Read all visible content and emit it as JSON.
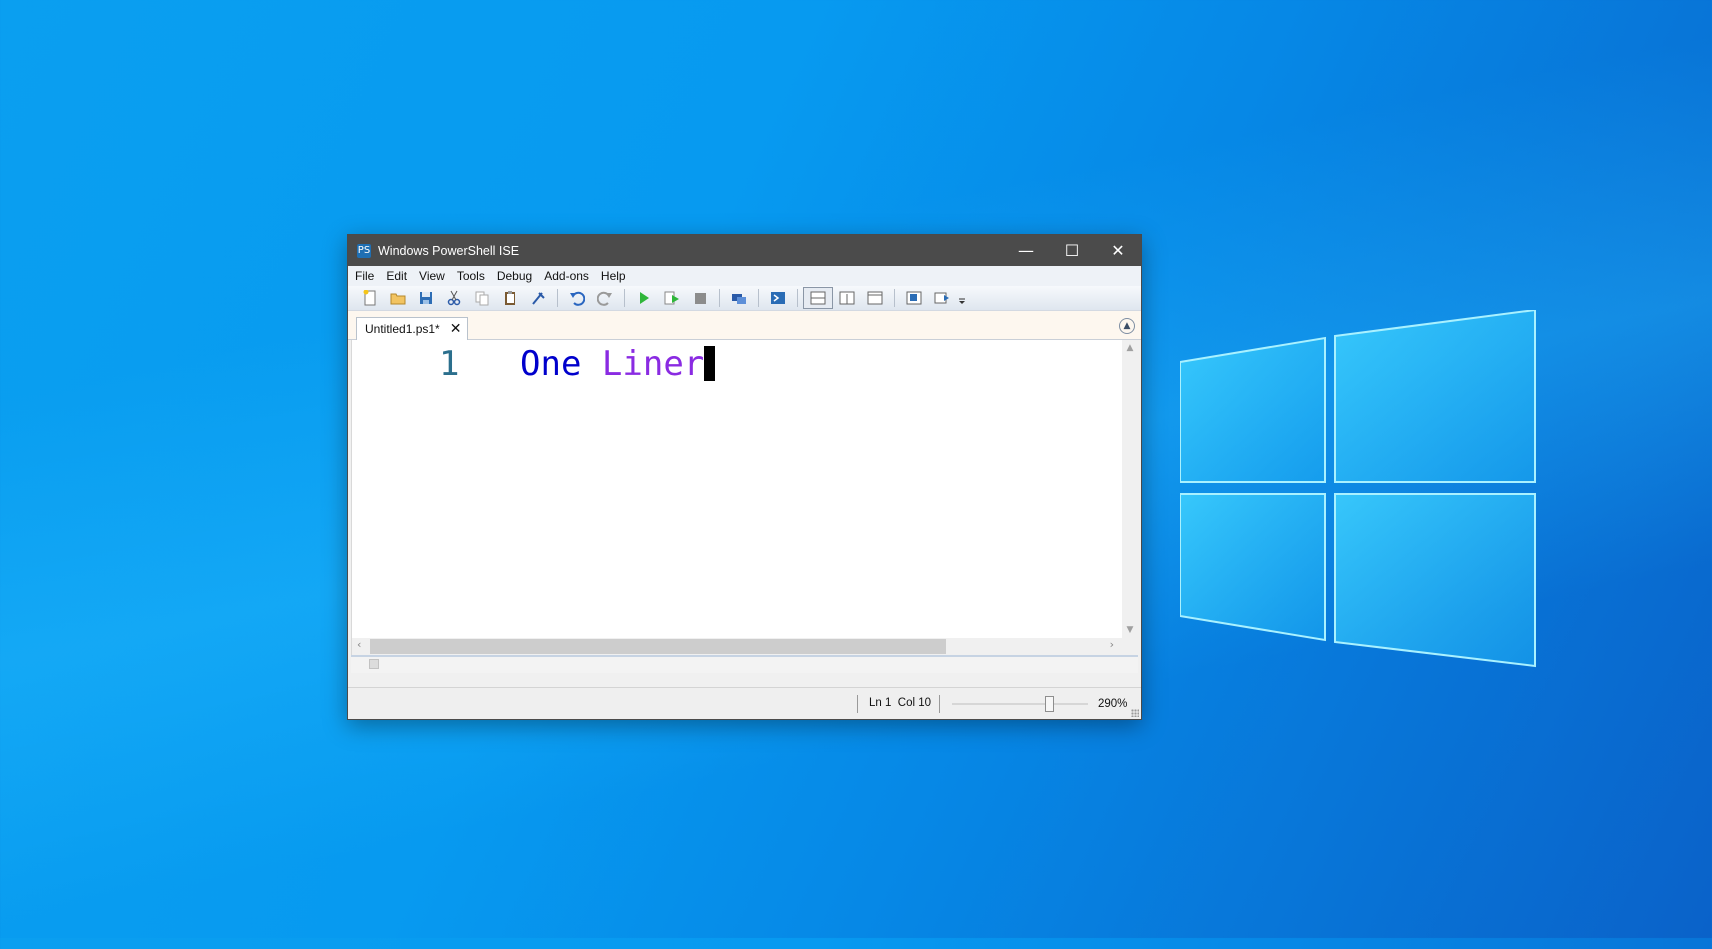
{
  "window": {
    "title": "Windows PowerShell ISE",
    "app_icon": "PS",
    "controls": {
      "minimize": "—",
      "maximize": "☐",
      "close": "✕"
    }
  },
  "menu": {
    "items": [
      "File",
      "Edit",
      "View",
      "Tools",
      "Debug",
      "Add-ons",
      "Help"
    ]
  },
  "toolbar": {
    "icons": [
      "new-file-icon",
      "open-folder-icon",
      "save-icon",
      "cut-icon",
      "copy-icon",
      "paste-icon",
      "clear-console-icon",
      "undo-icon",
      "redo-icon",
      "run-icon",
      "run-selection-icon",
      "stop-icon",
      "remote-tab-icon",
      "powershell-console-icon",
      "layout-top-icon",
      "layout-right-icon",
      "layout-max-icon",
      "show-command-icon",
      "show-addon-icon",
      "toolbar-overflow-icon"
    ]
  },
  "tabs": [
    {
      "label": "Untitled1.ps1*",
      "close": "✕"
    }
  ],
  "editor": {
    "line_number": "1",
    "tokens": [
      {
        "text": "One",
        "type": "command"
      },
      {
        "text": " "
      },
      {
        "text": "Liner",
        "type": "argument"
      }
    ],
    "colors": {
      "command": "#0000cc",
      "argument": "#8a2be2",
      "line_number": "#2b6f8d"
    }
  },
  "status": {
    "position": "Ln 1  Col 10",
    "zoom": "290%"
  },
  "desktop": {
    "background": "#0a8fe9",
    "logo": "windows-logo"
  }
}
